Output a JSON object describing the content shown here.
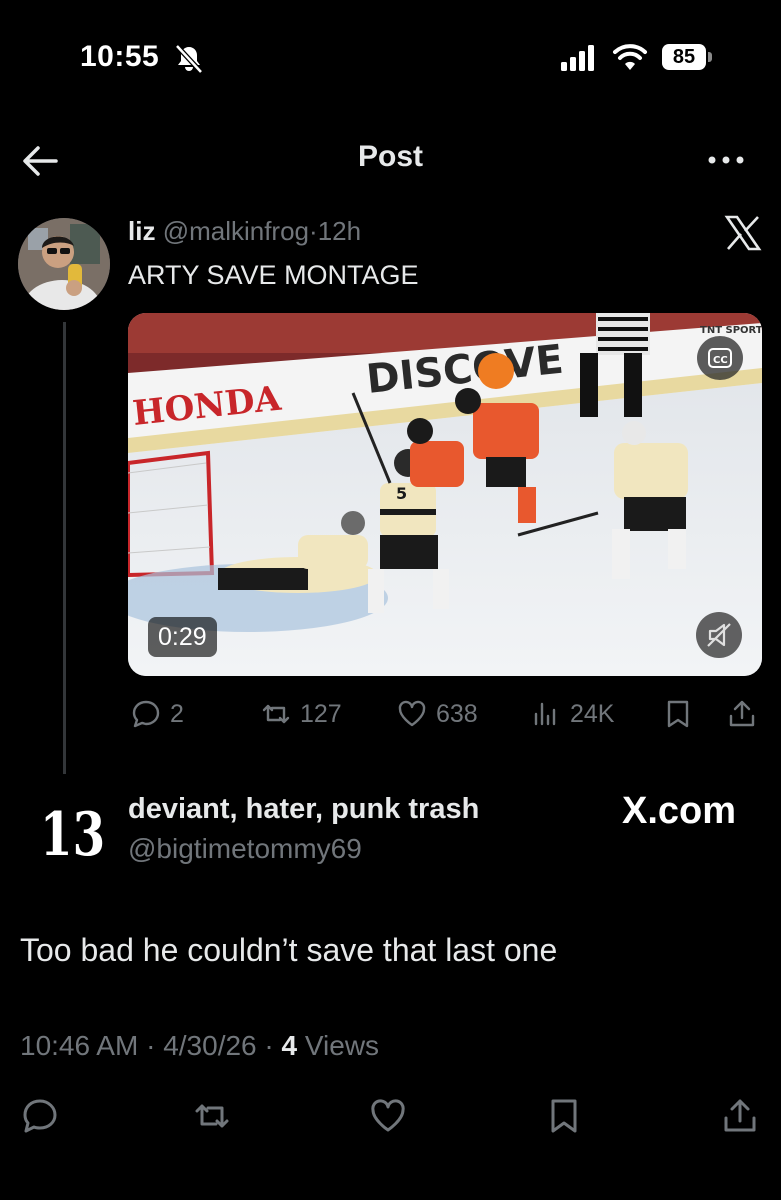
{
  "status_bar": {
    "time": "10:55",
    "battery": "85",
    "icons": [
      "bell-slash-icon",
      "cellular-signal-icon",
      "wifi-icon",
      "battery-icon"
    ]
  },
  "header": {
    "title": "Post",
    "back_icon": "back-arrow-icon",
    "more_icon": "more-icon"
  },
  "quoted_post": {
    "display_name": "liz",
    "handle": "@malkinfrog",
    "separator": "·",
    "age": "12h",
    "text": "ARTY SAVE MONTAGE",
    "video": {
      "duration": "0:29",
      "rink_board_text": [
        "HONDA",
        "DISCOVE"
      ],
      "jersey_number": "5",
      "watermark": "TNT SPORTS"
    },
    "actions": {
      "replies": "2",
      "reposts": "127",
      "likes": "638",
      "views": "24K"
    }
  },
  "reply": {
    "logo_text": "13",
    "display_name": "deviant, hater, punk trash",
    "handle": "@bigtimetommy69",
    "badge": "X.com",
    "text": "Too bad he couldn’t save that last one",
    "time": "10:46 AM",
    "date": "4/30/26",
    "sep": "·",
    "views_count": "4",
    "views_label": "Views"
  },
  "colors": {
    "background": "#000000",
    "text": "#e7e9ea",
    "muted": "#71767b",
    "divider": "#333639"
  }
}
